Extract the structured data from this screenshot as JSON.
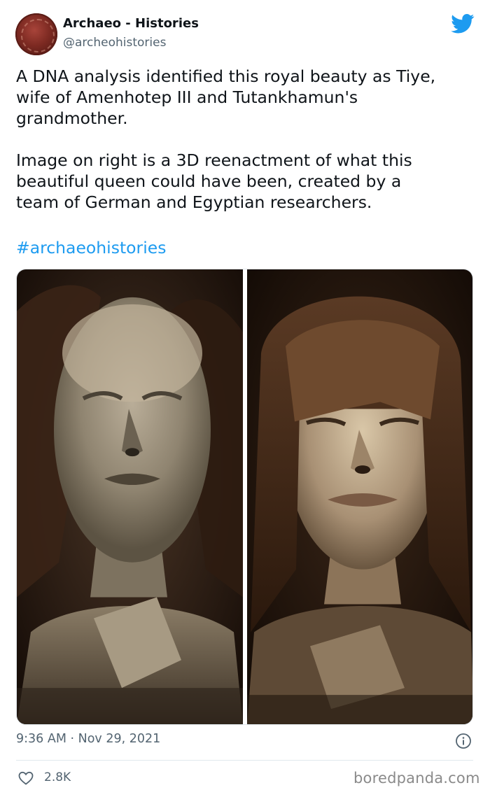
{
  "author": {
    "display_name": "Archaeo - Histories",
    "handle": "@archeohistories"
  },
  "tweet": {
    "text": "A DNA analysis identified this royal beauty as Tiye,\nwife of Amenhotep III and Tutankhamun's\ngrandmother.\n\nImage on right is a 3D reenactment of what this\nbeautiful queen could have been, created by a\nteam of German and Egyptian researchers.",
    "hashtag": "#archaeohistories",
    "timestamp": "9:36 AM · Nov 29, 2021",
    "likes": "2.8K"
  },
  "media": {
    "left_image": "mummy-photo",
    "right_image": "3d-reconstruction"
  },
  "icons": {
    "platform": "bird-icon",
    "info": "info-icon",
    "like": "heart-icon"
  },
  "watermark": "boredpanda.com",
  "colors": {
    "link": "#1d9bf0",
    "secondary_text": "#536471",
    "primary_text": "#0f1419"
  }
}
